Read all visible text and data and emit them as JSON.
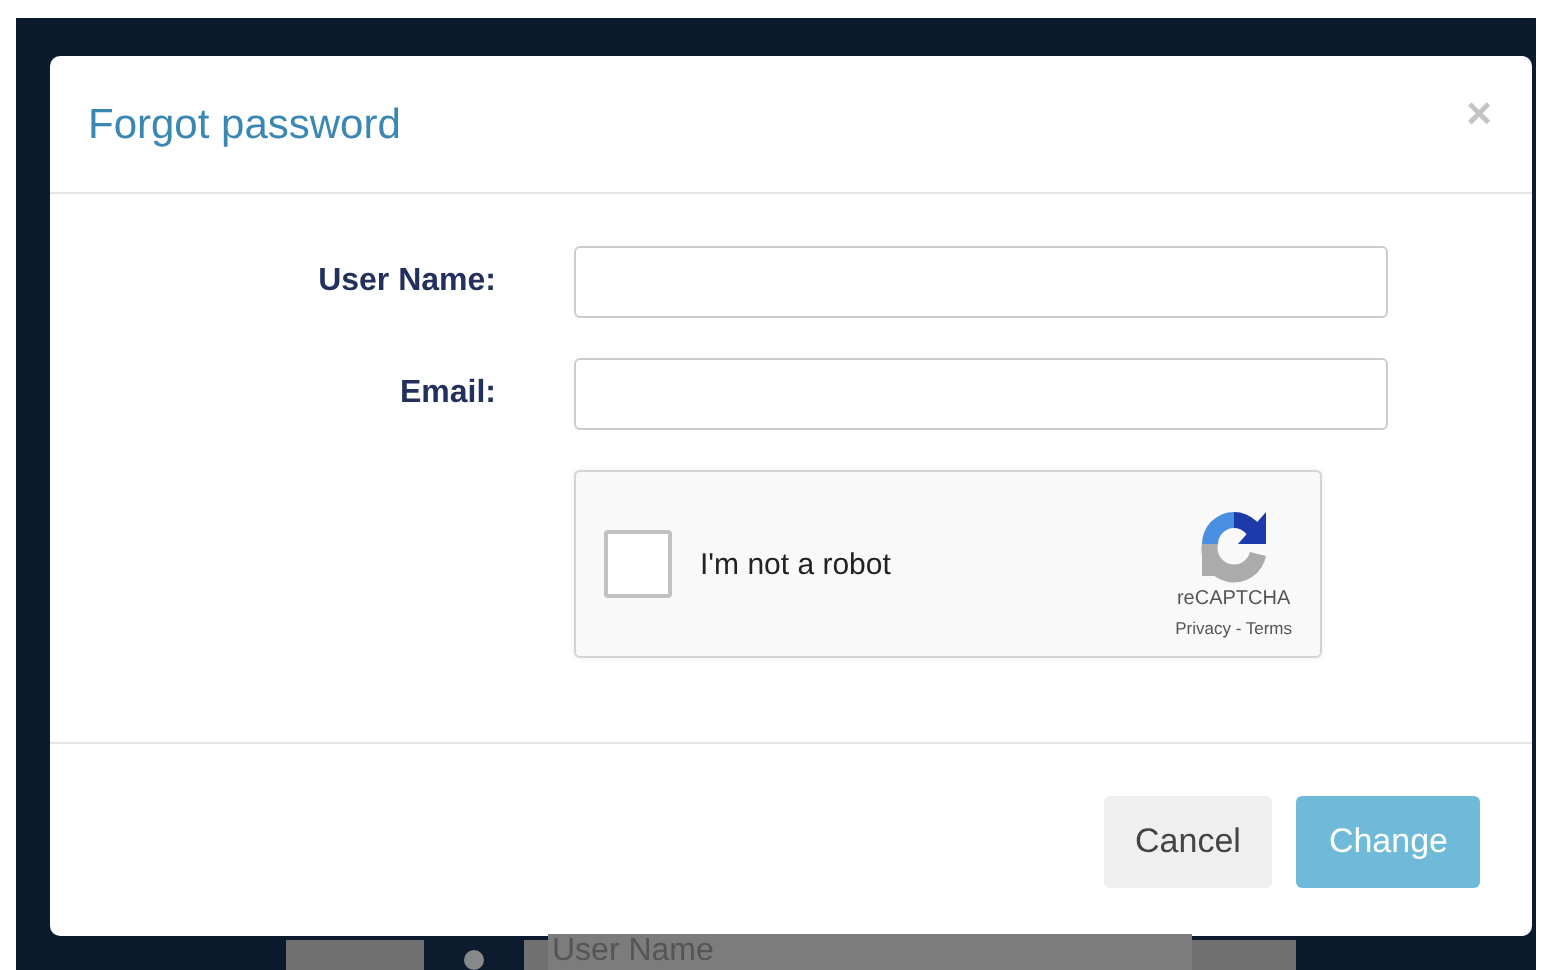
{
  "dialog": {
    "title": "Forgot password",
    "close": "×",
    "fields": [
      {
        "label": "User Name:"
      },
      {
        "label": "Email:"
      }
    ],
    "captcha": {
      "label": "I'm not a robot",
      "checked": false,
      "brand": "reCAPTCHA",
      "links": "Privacy - Terms"
    },
    "buttons": [
      {
        "label": "Cancel",
        "kind": "secondary"
      },
      {
        "label": "Change",
        "kind": "primary"
      }
    ]
  },
  "background": {
    "username_placeholder": "User Name"
  }
}
